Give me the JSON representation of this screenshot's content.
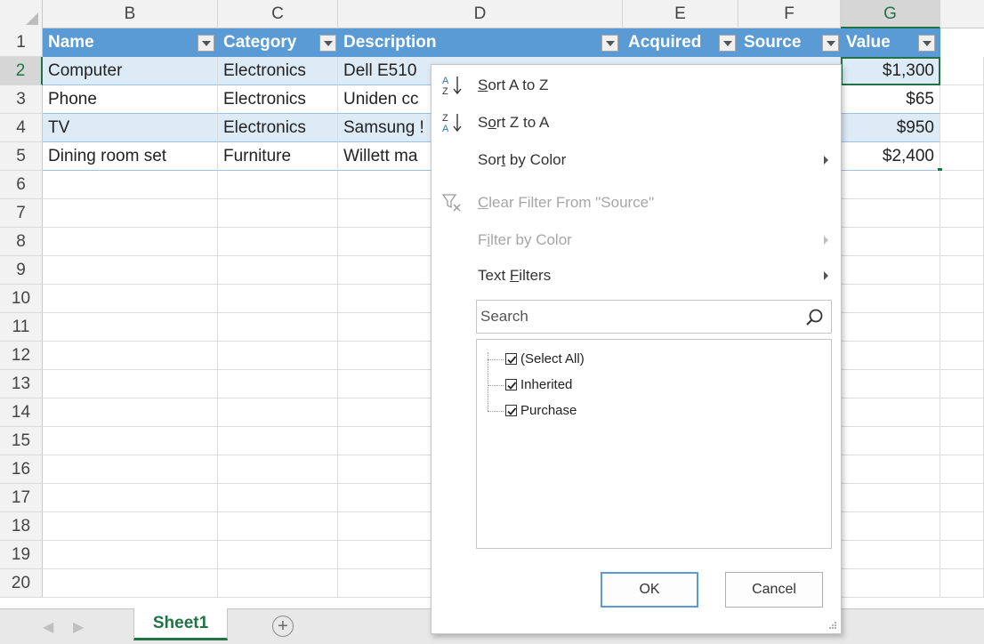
{
  "grid": {
    "column_headers": [
      "B",
      "C",
      "D",
      "E",
      "F",
      "G"
    ],
    "selected_column": "G",
    "row_numbers": [
      "1",
      "2",
      "3",
      "4",
      "5",
      "6",
      "7",
      "8",
      "9",
      "10",
      "11",
      "12",
      "13",
      "14",
      "15",
      "16",
      "17",
      "18",
      "19",
      "20"
    ],
    "selected_row": "2",
    "table_headers": [
      "Name",
      "Category",
      "Description",
      "Acquired",
      "Source",
      "Value"
    ],
    "rows": [
      {
        "name": "Computer",
        "category": "Electronics",
        "description": "Dell E510",
        "value": "$1,300"
      },
      {
        "name": "Phone",
        "category": "Electronics",
        "description": "Uniden cc",
        "value": "$65"
      },
      {
        "name": "TV",
        "category": "Electronics",
        "description": "Samsung !",
        "value": "$950"
      },
      {
        "name": "Dining room set",
        "category": "Furniture",
        "description": "Willett ma",
        "value": "$2,400"
      }
    ],
    "header_color": "#5b9bd5",
    "band_color": "#ddebf7",
    "accent_color": "#217346"
  },
  "sheet_tabs": {
    "tabs": [
      "Sheet1"
    ],
    "active": "Sheet1",
    "add_sheet_icon": "plus-circle-icon"
  },
  "filter_menu": {
    "items": [
      {
        "pre": "",
        "key": "S",
        "post": "ort A to Z",
        "icon": "sort-a-to-z-icon",
        "disabled": false,
        "submenu": false
      },
      {
        "pre": "S",
        "key": "o",
        "post": "rt Z to A",
        "icon": "sort-z-to-a-icon",
        "disabled": false,
        "submenu": false
      },
      {
        "pre": "Sor",
        "key": "t",
        "post": " by Color",
        "icon": "",
        "disabled": false,
        "submenu": true
      },
      {
        "pre": "",
        "key": "C",
        "post": "lear Filter From \"Source\"",
        "icon": "clear-filter-icon",
        "disabled": true,
        "submenu": false
      },
      {
        "pre": "F",
        "key": "i",
        "post": "lter by Color",
        "icon": "",
        "disabled": true,
        "submenu": true
      },
      {
        "pre": "Text ",
        "key": "F",
        "post": "ilters",
        "icon": "",
        "disabled": false,
        "submenu": true
      }
    ],
    "search_placeholder": "Search",
    "checklist": [
      {
        "label": "(Select All)",
        "checked": true
      },
      {
        "label": "Inherited",
        "checked": true
      },
      {
        "label": "Purchase",
        "checked": true
      }
    ],
    "ok_label": "OK",
    "cancel_label": "Cancel"
  }
}
